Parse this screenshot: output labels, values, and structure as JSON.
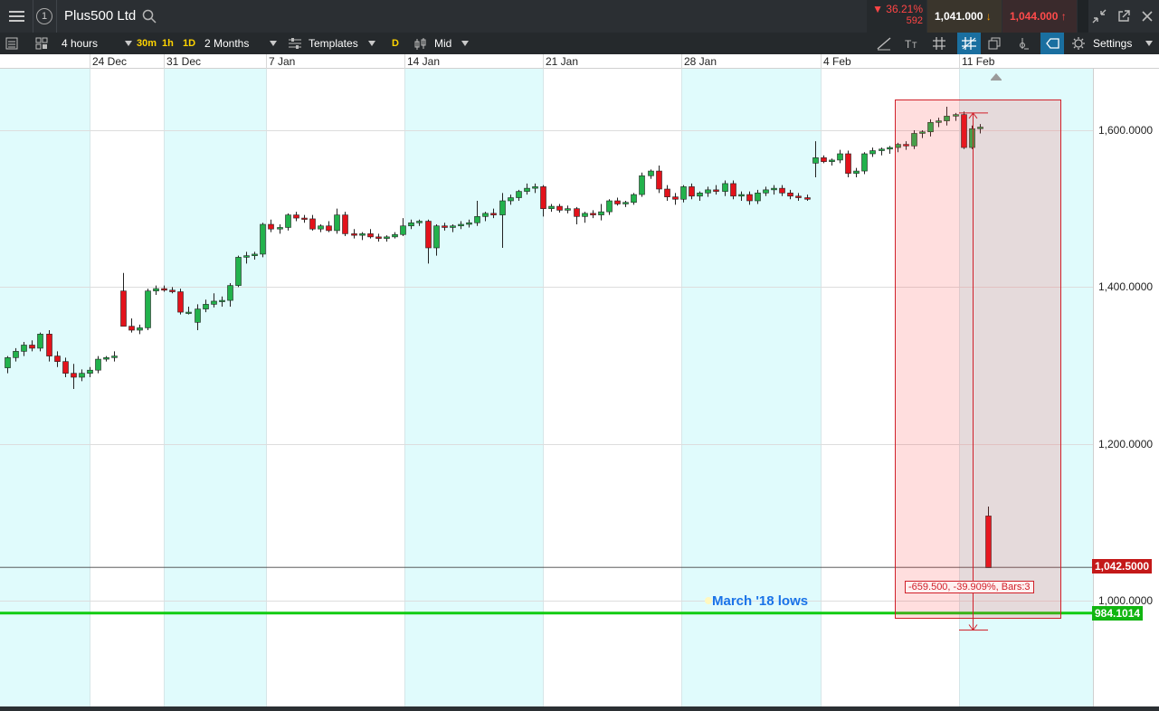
{
  "header": {
    "window_number": "1",
    "instrument": "Plus500 Ltd",
    "change_pct": "36.21%",
    "change_points": "592",
    "sell_price": "1,041.000",
    "buy_price": "1,044.000"
  },
  "toolbar": {
    "interval": "4 hours",
    "quick_30m": "30m",
    "quick_1h": "1h",
    "quick_1d": "1D",
    "range": "2 Months",
    "templates": "Templates",
    "d_badge": "D",
    "price_type": "Mid",
    "settings": "Settings"
  },
  "chart_data": {
    "type": "candlestick",
    "date_labels": [
      "24 Dec",
      "31 Dec",
      "7 Jan",
      "14 Jan",
      "21 Jan",
      "28 Jan",
      "4 Feb",
      "11 Feb"
    ],
    "y_tick_labels": [
      "1,600.0000",
      "1,400.0000",
      "1,200.0000",
      "1,000.0000"
    ],
    "ylim": [
      900,
      1720
    ],
    "current_price_label": "1,042.5000",
    "current_price": 1042.5,
    "support_label": "984.1014",
    "support_price": 984.1014,
    "annotation": "March '18 lows",
    "measure_label": "-659.500, -39.909%, Bars:3",
    "measure_from": 1622,
    "measure_to": 962.5,
    "colors": {
      "up": "#22b24c",
      "down": "#e3121b",
      "shade": "#e0fbfc",
      "support": "#11cc11",
      "measure": "#d0202a"
    },
    "candles": [
      [
        1297,
        1312,
        1290,
        1310
      ],
      [
        1310,
        1322,
        1305,
        1318
      ],
      [
        1318,
        1330,
        1312,
        1326
      ],
      [
        1326,
        1332,
        1318,
        1322
      ],
      [
        1322,
        1342,
        1318,
        1340
      ],
      [
        1340,
        1345,
        1305,
        1312
      ],
      [
        1312,
        1318,
        1298,
        1305
      ],
      [
        1305,
        1310,
        1285,
        1290
      ],
      [
        1290,
        1302,
        1270,
        1285
      ],
      [
        1285,
        1295,
        1280,
        1290
      ],
      [
        1290,
        1298,
        1285,
        1294
      ],
      [
        1294,
        1312,
        1290,
        1308
      ],
      [
        1308,
        1312,
        1305,
        1310
      ],
      [
        1310,
        1318,
        1305,
        1312
      ],
      [
        1395,
        1418,
        1352,
        1350
      ],
      [
        1350,
        1360,
        1342,
        1345
      ],
      [
        1345,
        1352,
        1340,
        1348
      ],
      [
        1348,
        1398,
        1345,
        1395
      ],
      [
        1395,
        1402,
        1390,
        1398
      ],
      [
        1398,
        1402,
        1394,
        1396
      ],
      [
        1396,
        1400,
        1392,
        1394
      ],
      [
        1394,
        1398,
        1365,
        1368
      ],
      [
        1368,
        1375,
        1365,
        1368
      ],
      [
        1355,
        1378,
        1345,
        1372
      ],
      [
        1372,
        1384,
        1368,
        1378
      ],
      [
        1378,
        1392,
        1374,
        1382
      ],
      [
        1382,
        1388,
        1375,
        1383
      ],
      [
        1383,
        1405,
        1375,
        1402
      ],
      [
        1402,
        1440,
        1400,
        1438
      ],
      [
        1438,
        1445,
        1430,
        1440
      ],
      [
        1440,
        1445,
        1435,
        1442
      ],
      [
        1442,
        1482,
        1438,
        1480
      ],
      [
        1480,
        1486,
        1470,
        1474
      ],
      [
        1474,
        1480,
        1468,
        1476
      ],
      [
        1476,
        1494,
        1472,
        1492
      ],
      [
        1492,
        1496,
        1484,
        1488
      ],
      [
        1488,
        1492,
        1482,
        1487
      ],
      [
        1487,
        1492,
        1472,
        1474
      ],
      [
        1474,
        1480,
        1470,
        1478
      ],
      [
        1478,
        1484,
        1470,
        1472
      ],
      [
        1472,
        1500,
        1468,
        1492
      ],
      [
        1492,
        1496,
        1465,
        1468
      ],
      [
        1468,
        1474,
        1462,
        1466
      ],
      [
        1466,
        1470,
        1460,
        1468
      ],
      [
        1468,
        1474,
        1462,
        1464
      ],
      [
        1464,
        1468,
        1458,
        1462
      ],
      [
        1462,
        1466,
        1458,
        1464
      ],
      [
        1464,
        1470,
        1462,
        1467
      ],
      [
        1467,
        1488,
        1465,
        1478
      ],
      [
        1478,
        1486,
        1474,
        1482
      ],
      [
        1482,
        1486,
        1478,
        1484
      ],
      [
        1484,
        1486,
        1430,
        1450
      ],
      [
        1450,
        1480,
        1440,
        1478
      ],
      [
        1478,
        1482,
        1472,
        1476
      ],
      [
        1476,
        1480,
        1470,
        1478
      ],
      [
        1478,
        1484,
        1474,
        1480
      ],
      [
        1480,
        1486,
        1476,
        1482
      ],
      [
        1482,
        1510,
        1478,
        1490
      ],
      [
        1490,
        1496,
        1484,
        1494
      ],
      [
        1494,
        1500,
        1488,
        1492
      ],
      [
        1492,
        1520,
        1450,
        1510
      ],
      [
        1510,
        1518,
        1505,
        1514
      ],
      [
        1514,
        1524,
        1510,
        1522
      ],
      [
        1522,
        1532,
        1518,
        1526
      ],
      [
        1526,
        1532,
        1520,
        1528
      ],
      [
        1528,
        1530,
        1490,
        1500
      ],
      [
        1500,
        1506,
        1496,
        1503
      ],
      [
        1503,
        1506,
        1495,
        1498
      ],
      [
        1498,
        1504,
        1494,
        1500
      ],
      [
        1500,
        1502,
        1480,
        1490
      ],
      [
        1490,
        1496,
        1482,
        1494
      ],
      [
        1494,
        1498,
        1488,
        1492
      ],
      [
        1492,
        1506,
        1485,
        1496
      ],
      [
        1496,
        1512,
        1492,
        1510
      ],
      [
        1510,
        1514,
        1504,
        1506
      ],
      [
        1506,
        1510,
        1502,
        1508
      ],
      [
        1508,
        1520,
        1505,
        1518
      ],
      [
        1518,
        1546,
        1515,
        1542
      ],
      [
        1542,
        1550,
        1538,
        1548
      ],
      [
        1548,
        1555,
        1520,
        1525
      ],
      [
        1525,
        1530,
        1510,
        1515
      ],
      [
        1515,
        1520,
        1505,
        1512
      ],
      [
        1512,
        1530,
        1508,
        1528
      ],
      [
        1528,
        1532,
        1512,
        1516
      ],
      [
        1516,
        1522,
        1510,
        1520
      ],
      [
        1520,
        1528,
        1515,
        1524
      ],
      [
        1524,
        1530,
        1518,
        1522
      ],
      [
        1522,
        1536,
        1516,
        1532
      ],
      [
        1532,
        1536,
        1512,
        1516
      ],
      [
        1516,
        1522,
        1510,
        1518
      ],
      [
        1518,
        1522,
        1505,
        1510
      ],
      [
        1510,
        1524,
        1506,
        1520
      ],
      [
        1520,
        1528,
        1516,
        1524
      ],
      [
        1524,
        1530,
        1518,
        1526
      ],
      [
        1526,
        1530,
        1516,
        1520
      ],
      [
        1520,
        1524,
        1512,
        1516
      ],
      [
        1516,
        1520,
        1510,
        1514
      ],
      [
        1514,
        1518,
        1510,
        1512
      ],
      [
        1558,
        1586,
        1540,
        1565
      ],
      [
        1565,
        1568,
        1558,
        1560
      ],
      [
        1560,
        1564,
        1555,
        1562
      ],
      [
        1562,
        1575,
        1558,
        1570
      ],
      [
        1570,
        1574,
        1540,
        1545
      ],
      [
        1545,
        1552,
        1540,
        1548
      ],
      [
        1548,
        1572,
        1544,
        1570
      ],
      [
        1570,
        1578,
        1566,
        1574
      ],
      [
        1574,
        1578,
        1568,
        1576
      ],
      [
        1576,
        1580,
        1570,
        1578
      ],
      [
        1578,
        1584,
        1572,
        1582
      ],
      [
        1582,
        1586,
        1575,
        1580
      ],
      [
        1580,
        1600,
        1576,
        1596
      ],
      [
        1596,
        1600,
        1590,
        1598
      ],
      [
        1598,
        1614,
        1592,
        1610
      ],
      [
        1610,
        1616,
        1604,
        1612
      ],
      [
        1612,
        1630,
        1606,
        1618
      ],
      [
        1618,
        1622,
        1612,
        1620
      ],
      [
        1620,
        1624,
        1576,
        1578
      ],
      [
        1578,
        1606,
        1576,
        1602
      ],
      [
        1602,
        1608,
        1596,
        1604
      ],
      [
        1108,
        1120,
        1042,
        1042
      ]
    ]
  }
}
